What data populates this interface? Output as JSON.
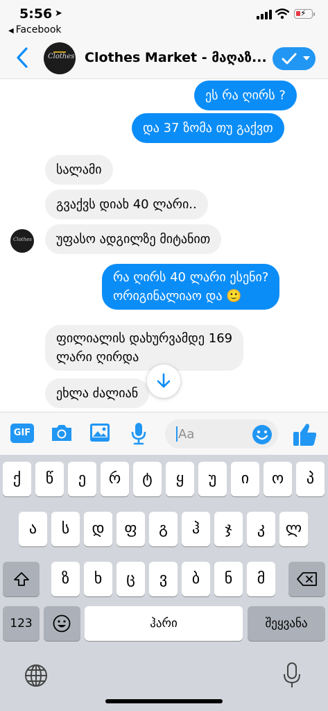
{
  "status_bar": {
    "time": "5:56",
    "back_app": "Facebook"
  },
  "header": {
    "title": "Clothes Market - მაღაზ...",
    "avatar_text": "Clothes"
  },
  "messages": [
    {
      "direction": "out",
      "lines": [
        "ეს რა ღირს ?"
      ]
    },
    {
      "direction": "out",
      "lines": [
        "და 37 ზომა თუ გაქვთ"
      ]
    },
    {
      "direction": "in",
      "lines": [
        "სალამი"
      ]
    },
    {
      "direction": "in",
      "lines": [
        "გვაქვს დიახ 40 ლარი.."
      ]
    },
    {
      "direction": "in",
      "lines": [
        "უფასო ადგილზე მიტანით"
      ]
    },
    {
      "direction": "out",
      "lines": [
        "რა ღირს 40 ლარი ესენი?",
        "ორიგინალიაო და 🙂"
      ]
    },
    {
      "direction": "in",
      "lines": [
        "ფილიალის დახურვამდე 169",
        "ლარი ღირდა"
      ]
    },
    {
      "direction": "in",
      "lines": [
        "ეხლა ძალიან"
      ]
    }
  ],
  "composer": {
    "gif_label": "GIF",
    "placeholder": "Aa",
    "value": ""
  },
  "keyboard": {
    "row1": [
      "ქ",
      "წ",
      "ე",
      "რ",
      "ტ",
      "ყ",
      "უ",
      "ი",
      "ო",
      "პ"
    ],
    "row2": [
      "ა",
      "ს",
      "დ",
      "ფ",
      "გ",
      "ჰ",
      "ჯ",
      "კ",
      "ლ"
    ],
    "row3": [
      "ზ",
      "ხ",
      "ც",
      "ვ",
      "ბ",
      "ნ",
      "მ"
    ],
    "numbers_label": "123",
    "space_label": "ჰარი",
    "return_label": "შეყვანა"
  },
  "colors": {
    "accent": "#0b8df7",
    "incoming_bubble": "#f0f0f0",
    "keyboard_bg": "#d2d5db"
  }
}
